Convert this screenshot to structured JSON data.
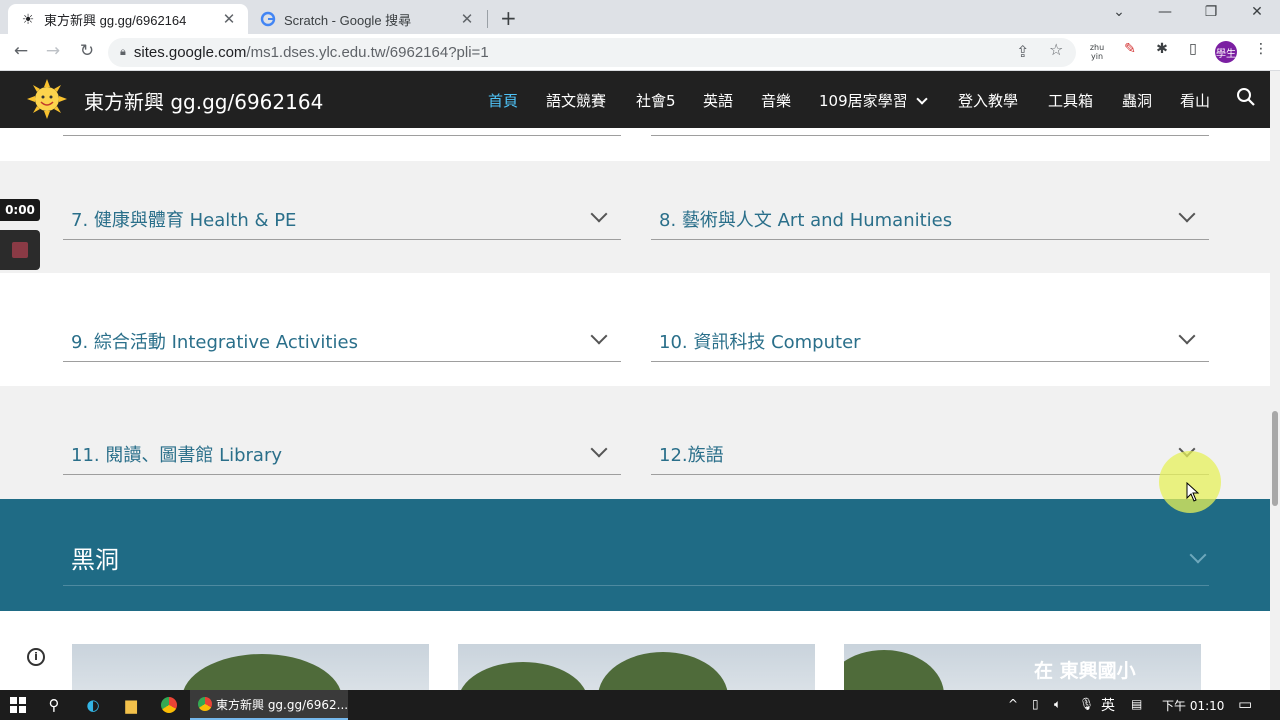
{
  "browser": {
    "tabs": [
      {
        "title": "東方新興 gg.gg/6962164",
        "active": true
      },
      {
        "title": "Scratch - Google 搜尋",
        "active": false
      }
    ],
    "url_host": "sites.google.com",
    "url_path": "/ms1.dses.ylc.edu.tw/6962164?pli=1",
    "ext_zhuyin": "zhu yin",
    "profile_label": "學生"
  },
  "site": {
    "title": "東方新興 gg.gg/6962164",
    "nav": [
      "首頁",
      "語文競賽",
      "社會5",
      "英語",
      "音樂",
      "109居家學習",
      "登入教學",
      "工具箱",
      "蟲洞",
      "看山"
    ]
  },
  "accordions": [
    {
      "label": "7. 健康與體育 Health & PE"
    },
    {
      "label": "8. 藝術與人文 Art and Humanities"
    },
    {
      "label": "9. 綜合活動 Integrative Activities"
    },
    {
      "label": "10. 資訊科技 Computer"
    },
    {
      "label": "11. 閱讀、圖書館 Library"
    },
    {
      "label": "12.族語"
    }
  ],
  "section_blackhole": {
    "title": "黑洞"
  },
  "photo_caption": "在 東興國小",
  "recorder": {
    "time": "0:00"
  },
  "taskbar": {
    "app_label": "東方新興 gg.gg/6962...",
    "ime": "英",
    "clock": "下午 01:10"
  },
  "colors": {
    "accent_link": "#2a6f8a",
    "teal_band": "#1f6b85",
    "nav_active": "#4fc3f7"
  }
}
